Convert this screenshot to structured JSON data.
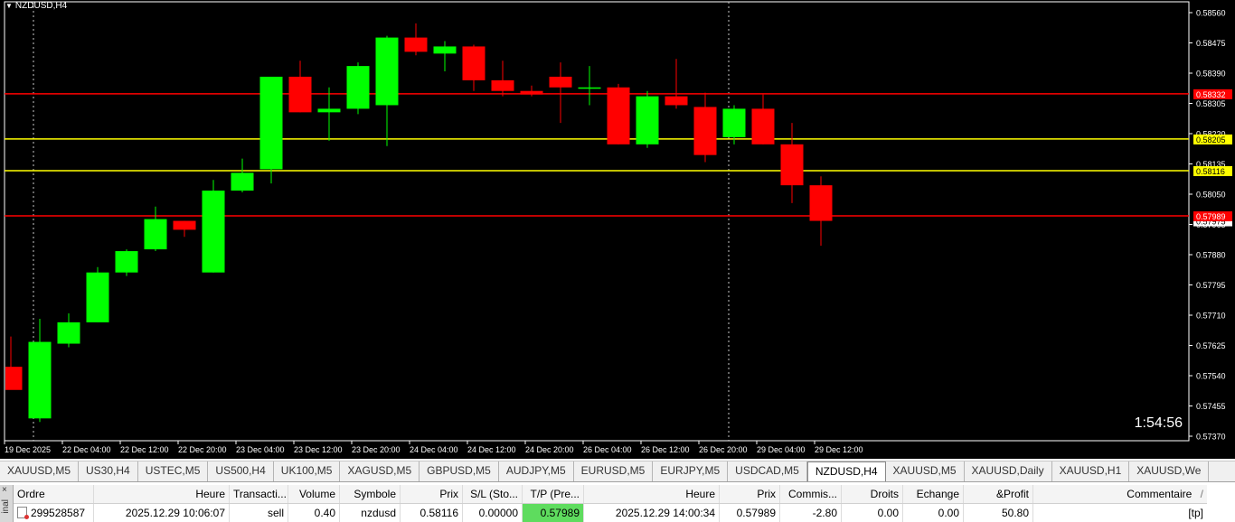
{
  "chart": {
    "symbol": "NZDUSD,H4",
    "timer": "1:54:56",
    "price_axis": [
      "0.58560",
      "0.58475",
      "0.58390",
      "0.58305",
      "0.58220",
      "0.58135",
      "0.58050",
      "0.57965",
      "0.57880",
      "0.57795",
      "0.57710",
      "0.57625",
      "0.57540",
      "0.57455",
      "0.57370"
    ],
    "price_range": [
      0.5737,
      0.5856
    ],
    "time_axis": [
      "19 Dec 2025",
      "22 Dec 04:00",
      "22 Dec 12:00",
      "22 Dec 20:00",
      "23 Dec 04:00",
      "23 Dec 12:00",
      "23 Dec 20:00",
      "24 Dec 04:00",
      "24 Dec 12:00",
      "24 Dec 20:00",
      "26 Dec 04:00",
      "26 Dec 12:00",
      "26 Dec 20:00",
      "29 Dec 04:00",
      "29 Dec 12:00"
    ],
    "hlines": [
      {
        "price": 0.58332,
        "color": "#ff0000",
        "label": "0.58332"
      },
      {
        "price": 0.58205,
        "color": "#ffff00",
        "label": "0.58205"
      },
      {
        "price": 0.58116,
        "color": "#ffff00",
        "label": "0.58116"
      },
      {
        "price": 0.57989,
        "color": "#ff0000",
        "label": "0.57989"
      }
    ],
    "bid_label": "0.57975",
    "candles": [
      {
        "o": 0.57565,
        "h": 0.5765,
        "l": 0.5752,
        "c": 0.575
      },
      {
        "o": 0.5742,
        "h": 0.577,
        "l": 0.5741,
        "c": 0.57635
      },
      {
        "o": 0.5763,
        "h": 0.57715,
        "l": 0.5762,
        "c": 0.5769
      },
      {
        "o": 0.5769,
        "h": 0.57845,
        "l": 0.5769,
        "c": 0.5783
      },
      {
        "o": 0.5783,
        "h": 0.57895,
        "l": 0.5782,
        "c": 0.5789
      },
      {
        "o": 0.57895,
        "h": 0.58015,
        "l": 0.5789,
        "c": 0.5798
      },
      {
        "o": 0.57975,
        "h": 0.57975,
        "l": 0.5793,
        "c": 0.5795
      },
      {
        "o": 0.5783,
        "h": 0.5809,
        "l": 0.5783,
        "c": 0.5806
      },
      {
        "o": 0.5806,
        "h": 0.5815,
        "l": 0.58055,
        "c": 0.5811
      },
      {
        "o": 0.5812,
        "h": 0.5838,
        "l": 0.5808,
        "c": 0.5838
      },
      {
        "o": 0.5838,
        "h": 0.58425,
        "l": 0.5828,
        "c": 0.5828
      },
      {
        "o": 0.5828,
        "h": 0.5835,
        "l": 0.582,
        "c": 0.5829
      },
      {
        "o": 0.5829,
        "h": 0.5842,
        "l": 0.58275,
        "c": 0.5841
      },
      {
        "o": 0.583,
        "h": 0.58495,
        "l": 0.58185,
        "c": 0.5849
      },
      {
        "o": 0.5849,
        "h": 0.5853,
        "l": 0.5844,
        "c": 0.5845
      },
      {
        "o": 0.58445,
        "h": 0.5848,
        "l": 0.58395,
        "c": 0.58465
      },
      {
        "o": 0.58465,
        "h": 0.5847,
        "l": 0.5834,
        "c": 0.5837
      },
      {
        "o": 0.5837,
        "h": 0.58425,
        "l": 0.58325,
        "c": 0.5834
      },
      {
        "o": 0.5834,
        "h": 0.58355,
        "l": 0.58325,
        "c": 0.5833
      },
      {
        "o": 0.5838,
        "h": 0.5842,
        "l": 0.5825,
        "c": 0.5835
      },
      {
        "o": 0.5835,
        "h": 0.5841,
        "l": 0.583,
        "c": 0.5835
      },
      {
        "o": 0.5835,
        "h": 0.5836,
        "l": 0.5819,
        "c": 0.5819
      },
      {
        "o": 0.5819,
        "h": 0.5834,
        "l": 0.5818,
        "c": 0.58325
      },
      {
        "o": 0.58325,
        "h": 0.5843,
        "l": 0.5829,
        "c": 0.583
      },
      {
        "o": 0.58295,
        "h": 0.58335,
        "l": 0.5814,
        "c": 0.5816
      },
      {
        "o": 0.5821,
        "h": 0.583,
        "l": 0.5819,
        "c": 0.5829
      },
      {
        "o": 0.5829,
        "h": 0.5833,
        "l": 0.5819,
        "c": 0.5819
      },
      {
        "o": 0.5819,
        "h": 0.5825,
        "l": 0.58025,
        "c": 0.58075
      },
      {
        "o": 0.58075,
        "h": 0.581,
        "l": 0.57905,
        "c": 0.57975
      }
    ]
  },
  "tabs": [
    "XAUUSD,M5",
    "US30,H4",
    "USTEC,M5",
    "US500,H4",
    "UK100,M5",
    "XAGUSD,M5",
    "GBPUSD,M5",
    "AUDJPY,M5",
    "EURUSD,M5",
    "EURJPY,M5",
    "USDCAD,M5",
    "NZDUSD,H4",
    "XAUUSD,M5",
    "XAUUSD,Daily",
    "XAUUSD,H1",
    "XAUUSD,We"
  ],
  "active_tab": "NZDUSD,H4",
  "terminal": {
    "side_label": "inal",
    "close_glyph": "×",
    "headers": {
      "ordre": "Ordre",
      "heure": "Heure",
      "transaction": "Transacti...",
      "volume": "Volume",
      "symbole": "Symbole",
      "prix": "Prix",
      "sl": "S/L (Sto...",
      "tp": "T/P (Pre...",
      "heure2": "Heure",
      "prix2": "Prix",
      "commission": "Commis...",
      "droits": "Droits",
      "echange": "Echange",
      "profit": "&Profit",
      "commentaire": "Commentaire",
      "sort": "/"
    },
    "row": {
      "ordre": "299528587",
      "heure": "2025.12.29 10:06:07",
      "transaction": "sell",
      "volume": "0.40",
      "symbole": "nzdusd",
      "prix": "0.58116",
      "sl": "0.00000",
      "tp": "0.57989",
      "heure2": "2025.12.29 14:00:34",
      "prix2": "0.57989",
      "commission": "-2.80",
      "droits": "0.00",
      "echange": "0.00",
      "profit": "50.80",
      "commentaire": "[tp]"
    }
  },
  "colors": {
    "bull": "#00ff00",
    "bear": "#ff0000",
    "background": "#000000",
    "axis": "#ffffff",
    "tp_cell": "#5edc5e"
  }
}
